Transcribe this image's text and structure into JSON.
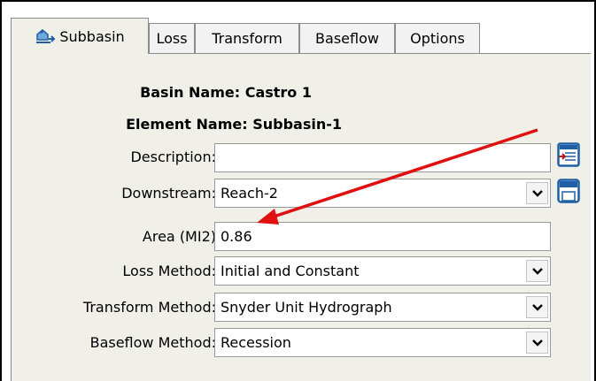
{
  "tabs": [
    {
      "label": "Subbasin",
      "icon": "subbasin-icon"
    },
    {
      "label": "Loss"
    },
    {
      "label": "Transform"
    },
    {
      "label": "Baseflow"
    },
    {
      "label": "Options"
    }
  ],
  "header": {
    "basin_name": "Basin Name: Castro 1",
    "element_name": "Element Name: Subbasin-1"
  },
  "fields": {
    "description": {
      "label": "Description:",
      "value": ""
    },
    "downstream": {
      "label": "Downstream:",
      "value": "Reach-2"
    },
    "area": {
      "label": "Area (MI2)",
      "value": "0.86"
    },
    "loss_method": {
      "label": "Loss Method:",
      "value": "Initial and Constant"
    },
    "transform_method": {
      "label": "Transform Method:",
      "value": "Snyder Unit Hydrograph"
    },
    "baseflow_method": {
      "label": "Baseflow Method:",
      "value": "Recession"
    }
  },
  "side_buttons": {
    "description_editor": "description-editor-icon",
    "downstream_editor": "downstream-editor-icon"
  },
  "colors": {
    "panel_bg": "#f0efe8",
    "annotation_arrow": "#e01010",
    "icon_blue": "#1f5fa6"
  }
}
